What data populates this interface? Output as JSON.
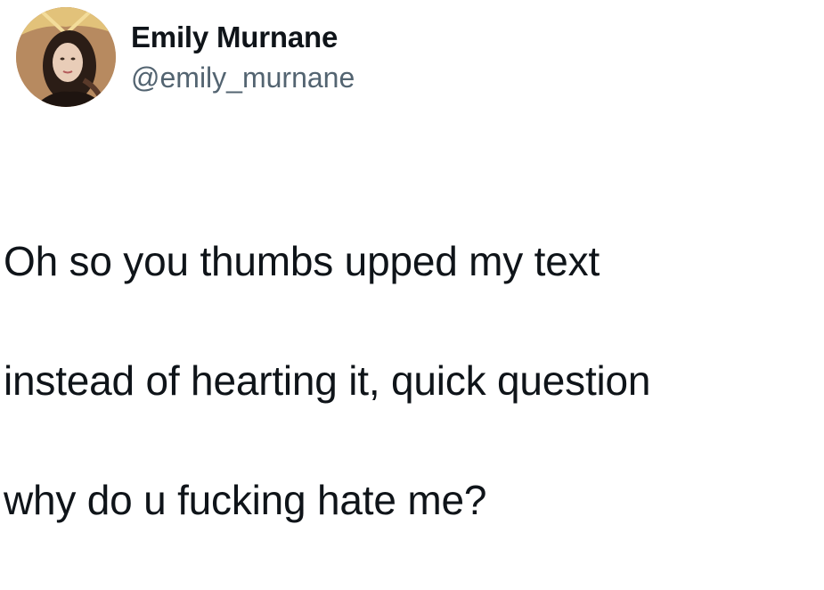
{
  "tweet": {
    "author": {
      "display_name": "Emily Murnane",
      "handle": "@emily_murnane",
      "avatar_icon": "profile-photo"
    },
    "text_lines": [
      "Oh so you thumbs upped my text",
      "instead of hearting it, quick question",
      "why do u fucking hate me?"
    ]
  },
  "colors": {
    "text_primary": "#0f1419",
    "text_secondary": "#536471",
    "background": "#ffffff"
  }
}
